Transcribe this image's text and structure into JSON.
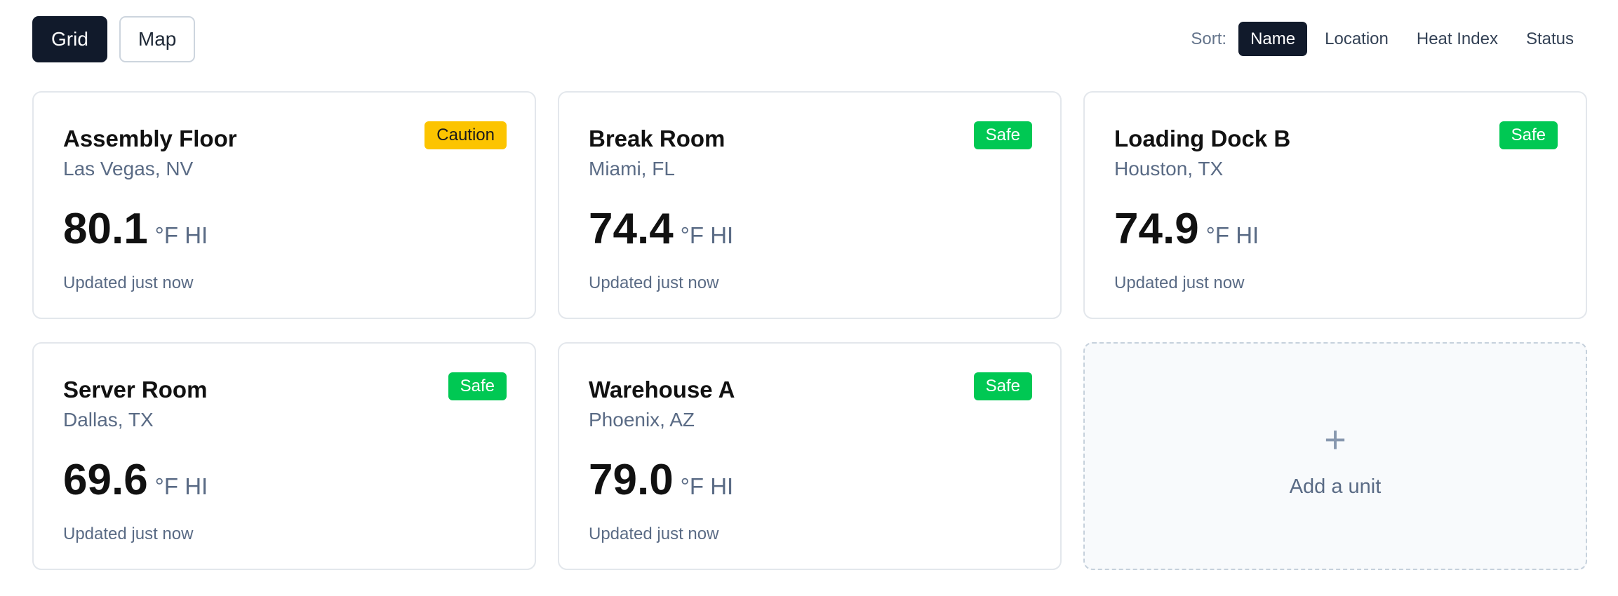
{
  "toolbar": {
    "view_grid": "Grid",
    "view_map": "Map",
    "sort_label": "Sort:",
    "sort_options": [
      "Name",
      "Location",
      "Heat Index",
      "Status"
    ],
    "active_sort": "Name"
  },
  "units": [
    {
      "name": "Assembly Floor",
      "location": "Las Vegas, NV",
      "status": "Caution",
      "value": "80.1",
      "unit": "°F HI",
      "updated": "Updated just now"
    },
    {
      "name": "Break Room",
      "location": "Miami, FL",
      "status": "Safe",
      "value": "74.4",
      "unit": "°F HI",
      "updated": "Updated just now"
    },
    {
      "name": "Loading Dock B",
      "location": "Houston, TX",
      "status": "Safe",
      "value": "74.9",
      "unit": "°F HI",
      "updated": "Updated just now"
    },
    {
      "name": "Server Room",
      "location": "Dallas, TX",
      "status": "Safe",
      "value": "69.6",
      "unit": "°F HI",
      "updated": "Updated just now"
    },
    {
      "name": "Warehouse A",
      "location": "Phoenix, AZ",
      "status": "Safe",
      "value": "79.0",
      "unit": "°F HI",
      "updated": "Updated just now"
    }
  ],
  "add_card": {
    "icon": "plus-icon",
    "label": "Add a unit"
  },
  "colors": {
    "dark": "#111a2b",
    "safe": "#00c853",
    "caution": "#fcc400",
    "muted": "#5a6b85"
  }
}
